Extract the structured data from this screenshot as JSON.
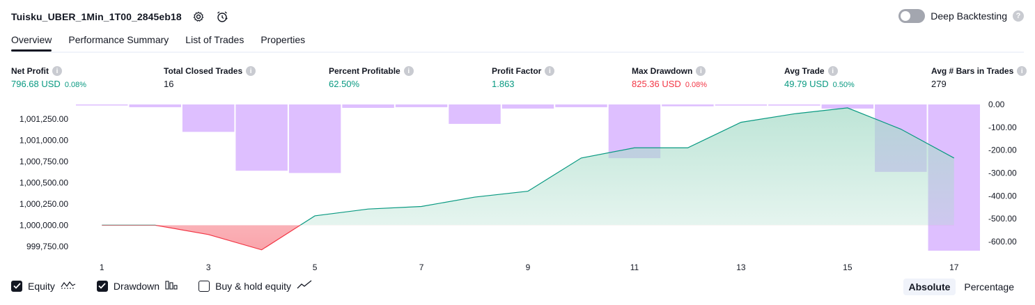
{
  "header": {
    "strategy_name": "Tuisku_UBER_1Min_1T00_2845eb18",
    "deep_backtesting_label": "Deep Backtesting",
    "help_glyph": "?"
  },
  "tabs": [
    {
      "label": "Overview"
    },
    {
      "label": "Performance Summary"
    },
    {
      "label": "List of Trades"
    },
    {
      "label": "Properties"
    }
  ],
  "metrics": [
    {
      "label": "Net Profit",
      "value": "796.68 USD",
      "pct": "0.08%",
      "tone": "pos"
    },
    {
      "label": "Total Closed Trades",
      "value": "16",
      "pct": "",
      "tone": "neutral"
    },
    {
      "label": "Percent Profitable",
      "value": "62.50%",
      "pct": "",
      "tone": "pos"
    },
    {
      "label": "Profit Factor",
      "value": "1.863",
      "pct": "",
      "tone": "pos"
    },
    {
      "label": "Max Drawdown",
      "value": "825.36 USD",
      "pct": "0.08%",
      "tone": "neg"
    },
    {
      "label": "Avg Trade",
      "value": "49.79 USD",
      "pct": "0.50%",
      "tone": "pos"
    },
    {
      "label": "Avg # Bars in Trades",
      "value": "279",
      "pct": "",
      "tone": "neutral"
    }
  ],
  "info_glyph": "i",
  "colors": {
    "equity_line": "#089981",
    "equity_fill": "#a8dcc9",
    "equity_negative": "#f23645",
    "drawdown_bar": "#d1a6ff",
    "text": "#131722",
    "axis_text": "#131722"
  },
  "chart_data": {
    "type": "line",
    "x": [
      1,
      2,
      3,
      4,
      5,
      6,
      7,
      8,
      9,
      10,
      11,
      12,
      13,
      14,
      15,
      16,
      17
    ],
    "x_tick_labels": [
      "1",
      "3",
      "5",
      "7",
      "9",
      "11",
      "13",
      "15",
      "17"
    ],
    "series": [
      {
        "name": "Equity",
        "axis": "left",
        "values": [
          1000000,
          1000000,
          999890,
          999710,
          1000110,
          1000190,
          1000220,
          1000330,
          1000400,
          1000790,
          1000910,
          1000910,
          1001210,
          1001310,
          1001380,
          1001130,
          1000790
        ]
      },
      {
        "name": "Drawdown",
        "axis": "right",
        "type": "bar",
        "values": [
          -3,
          -12,
          -120,
          -290,
          -300,
          -15,
          -12,
          -85,
          -18,
          -12,
          -235,
          -8,
          -5,
          -5,
          -18,
          -295,
          -640
        ]
      }
    ],
    "left_axis": {
      "ticks": [
        999750,
        1000000,
        1000250,
        1000500,
        1000750,
        1001000,
        1001250
      ],
      "tick_labels": [
        "999,750.00",
        "1,000,000.00",
        "1,000,250.00",
        "1,000,500.00",
        "1,000,750.00",
        "1,001,000.00",
        "1,001,250.00"
      ],
      "range": [
        999700,
        1001420
      ]
    },
    "right_axis": {
      "ticks": [
        0,
        -100,
        -200,
        -300,
        -400,
        -500,
        -600
      ],
      "tick_labels": [
        "0.00",
        "-100.00",
        "-200.00",
        "-300.00",
        "-400.00",
        "-500.00",
        "-600.00"
      ],
      "range": [
        -640,
        0
      ]
    },
    "baseline": 1000000
  },
  "legend": [
    {
      "label": "Equity",
      "checked": true,
      "icon": "equity-wave-icon"
    },
    {
      "label": "Drawdown",
      "checked": true,
      "icon": "drawdown-bars-icon"
    },
    {
      "label": "Buy & hold equity",
      "checked": false,
      "icon": "buy-hold-line-icon"
    }
  ],
  "modes": [
    {
      "label": "Absolute",
      "active": true
    },
    {
      "label": "Percentage",
      "active": false
    }
  ]
}
